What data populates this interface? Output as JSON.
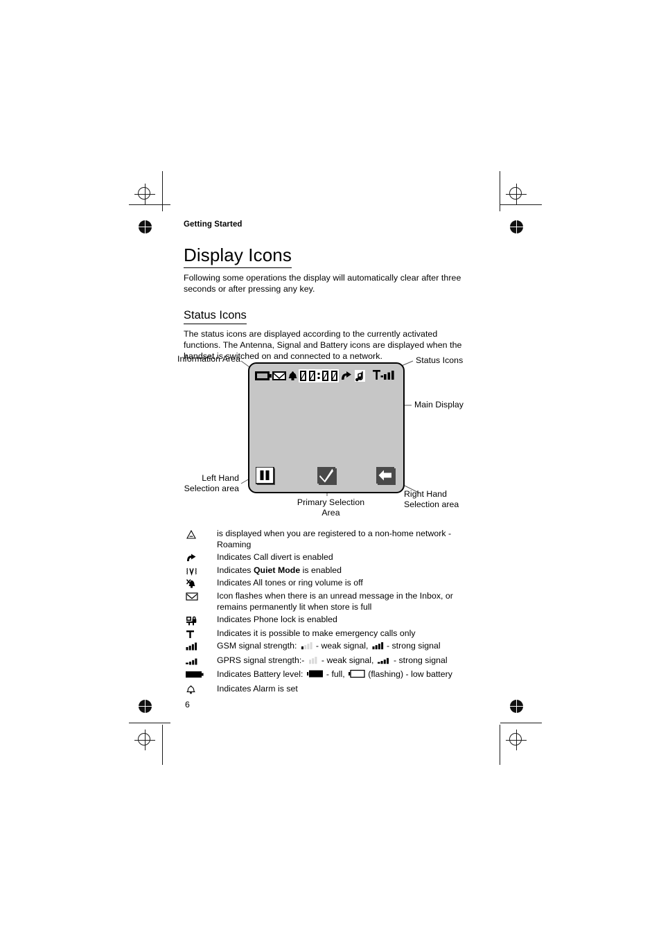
{
  "page": {
    "running_head": "Getting Started",
    "title": "Display Icons",
    "intro": "Following some operations the display will automatically clear after three seconds or after pressing any key.",
    "subtitle": "Status Icons",
    "subtitle_body": "The status icons are displayed according to the currently activated functions. The Antenna, Signal and Battery icons are displayed when the handset is switched on and connected to a network.",
    "page_number": "6"
  },
  "diagram": {
    "callouts": {
      "information_area": "Information Area",
      "status_icons": "Status Icons",
      "main_display": "Main Display",
      "left_hand_line1": "Left Hand",
      "left_hand_line2": "Selection area",
      "right_hand_line1": "Right Hand",
      "right_hand_line2": "Selection area",
      "primary_line1": "Primary Selection",
      "primary_line2": "Area"
    },
    "status_bar_icons": [
      "battery-icon",
      "envelope-icon",
      "alarm-bell-icon",
      "clock-digit-0",
      "clock-digit-0",
      "clock-colon",
      "clock-digit-0",
      "clock-digit-0",
      "call-divert-icon",
      "music-note-icon",
      "antenna-signal-icon"
    ],
    "clock_value": "00:00",
    "softkeys": [
      "pause-bars-icon",
      "checkmark-icon",
      "left-arrow-icon"
    ],
    "screen_color": "#c6c6c6"
  },
  "legend": {
    "rows": [
      {
        "icon": "roaming-triangle-icon",
        "text": "is displayed when you are registered to a non-home network - Roaming"
      },
      {
        "icon": "call-divert-icon",
        "text": "Indicates Call divert is enabled"
      },
      {
        "icon": "quiet-mode-icon",
        "text_before": "Indicates ",
        "text_bold": "Quiet Mode",
        "text_after": " is enabled"
      },
      {
        "icon": "muted-bell-icon",
        "text": "Indicates All tones or ring volume is off"
      },
      {
        "icon": "envelope-icon",
        "text": "Icon flashes when there is an unread message in the Inbox, or remains permanently lit when store is full"
      },
      {
        "icon": "phone-lock-icon",
        "text": "Indicates Phone lock is enabled"
      },
      {
        "icon": "emergency-antenna-icon",
        "text": "Indicates it is possible to make emergency calls only"
      },
      {
        "icon": "gsm-signal-icon",
        "label": "GSM signal strength:",
        "weak_text": "- weak signal,",
        "strong_text": "- strong signal"
      },
      {
        "icon": "gprs-signal-icon",
        "label": "GPRS signal strength:-",
        "weak_text": "- weak signal,",
        "strong_text": "- strong signal"
      },
      {
        "icon": "battery-icon",
        "label": "Indicates Battery level:",
        "full_text": "- full,",
        "low_text": "(flashing) - low battery"
      },
      {
        "icon": "alarm-bell-icon",
        "text": "Indicates Alarm is set"
      }
    ]
  }
}
